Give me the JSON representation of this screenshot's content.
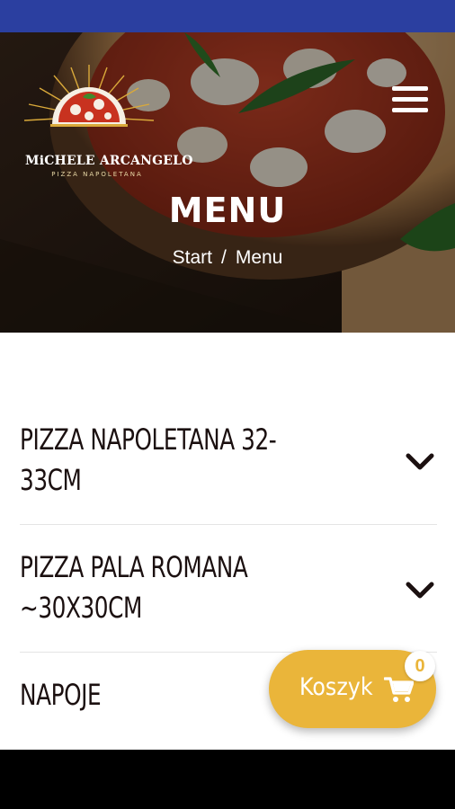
{
  "hero": {
    "logo_name": "MiCHELE ARCANGELO",
    "logo_sub": "PIZZA NAPOLETANA",
    "title": "MENU",
    "breadcrumb": {
      "home": "Start",
      "separator": "/",
      "current": "Menu"
    }
  },
  "menu": {
    "categories": [
      {
        "label": "PIZZA NAPOLETANA 32-\n33CM"
      },
      {
        "label": "PIZZA PALA ROMANA\n~30X30CM"
      },
      {
        "label": "NAPOJE"
      }
    ]
  },
  "cart": {
    "label": "Koszyk",
    "count": "0"
  },
  "colors": {
    "status_bar": "#2b3fa0",
    "accent": "#eab53a",
    "text_dark": "#1b1010"
  },
  "icons": {
    "menu": "hamburger-menu-icon",
    "expand": "chevron-down-icon",
    "cart": "shopping-cart-icon"
  }
}
